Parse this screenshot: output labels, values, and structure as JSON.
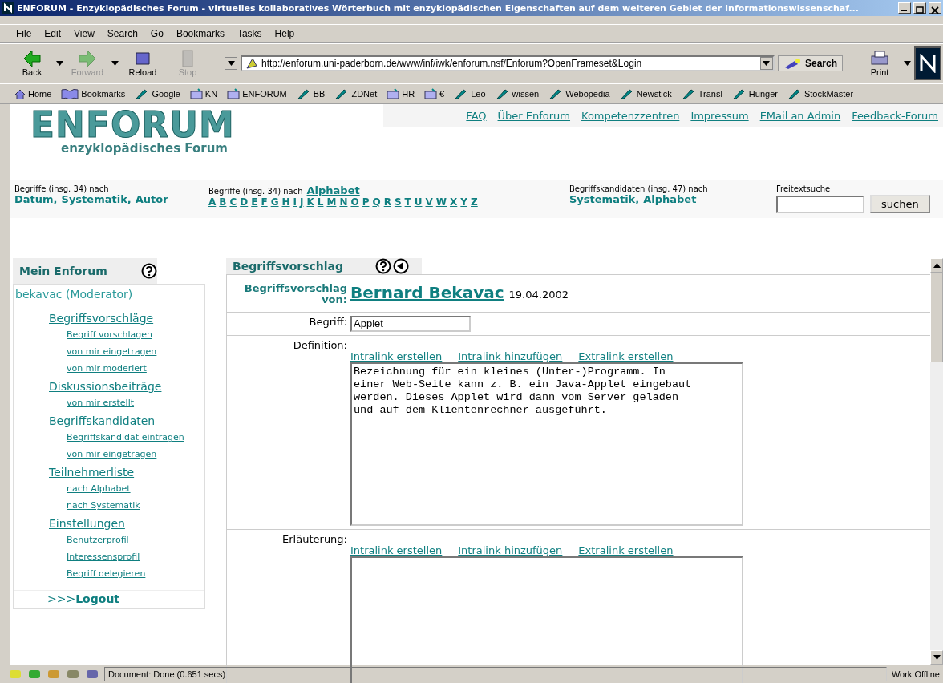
{
  "window": {
    "title": "ENFORUM - Enzyklopädisches Forum - virtuelles kollaboratives Wörterbuch mit enzyklopädischen Eigenschaften auf dem weiteren Gebiet der Informationswissenschaf..."
  },
  "menu": [
    "File",
    "Edit",
    "View",
    "Search",
    "Go",
    "Bookmarks",
    "Tasks",
    "Help"
  ],
  "toolbar": {
    "buttons": [
      {
        "label": "Back",
        "disabled": false,
        "dropdown": true
      },
      {
        "label": "Forward",
        "disabled": true,
        "dropdown": true
      },
      {
        "label": "Reload",
        "disabled": false,
        "dropdown": false
      },
      {
        "label": "Stop",
        "disabled": true,
        "dropdown": false
      }
    ],
    "url": "http://enforum.uni-paderborn.de/www/inf/iwk/enforum.nsf/Enforum?OpenFrameset&Login",
    "search": "Search",
    "print": "Print"
  },
  "bookmarks": [
    {
      "label": "Home",
      "kind": "home"
    },
    {
      "label": "Bookmarks",
      "kind": "book"
    },
    {
      "label": "Google",
      "kind": "link"
    },
    {
      "label": "KN",
      "kind": "folder"
    },
    {
      "label": "ENFORUM",
      "kind": "folder"
    },
    {
      "label": "BB",
      "kind": "link"
    },
    {
      "label": "ZDNet",
      "kind": "link"
    },
    {
      "label": "HR",
      "kind": "folder"
    },
    {
      "label": "€",
      "kind": "folder"
    },
    {
      "label": "Leo",
      "kind": "link"
    },
    {
      "label": "wissen",
      "kind": "link"
    },
    {
      "label": "Webopedia",
      "kind": "link"
    },
    {
      "label": "Newstick",
      "kind": "link"
    },
    {
      "label": "Transl",
      "kind": "link"
    },
    {
      "label": "Hunger",
      "kind": "link"
    },
    {
      "label": "StockMaster",
      "kind": "link"
    }
  ],
  "site": {
    "logo": "ENFORUM",
    "logo_subtitle": "enzyklopädisches Forum",
    "top_links": [
      "FAQ",
      "Über Enforum",
      "Kompetenzzentren",
      "Impressum",
      "EMail an Admin",
      "Feedback-Forum"
    ],
    "nav": [
      {
        "caption": "Begriffe (insg. 34)  nach",
        "links": [
          "Datum,",
          "Systematik,",
          "Autor"
        ]
      },
      {
        "caption": "Begriffe (insg. 34)  nach",
        "caption_link": "Alphabet",
        "letters": [
          "A",
          "B",
          "C",
          "D",
          "E",
          "F",
          "G",
          "H",
          "I",
          "J",
          "K",
          "L",
          "M",
          "N",
          "O",
          "P",
          "Q",
          "R",
          "S",
          "T",
          "U",
          "V",
          "W",
          "X",
          "Y",
          "Z"
        ]
      },
      {
        "caption": "Begriffskandidaten (insg. 47) nach",
        "links": [
          "Systematik,",
          "Alphabet"
        ]
      }
    ],
    "search": {
      "label": "Freitextsuche",
      "button": "suchen"
    }
  },
  "sidebar": {
    "title": "Mein Enforum",
    "user": "bekavac (Moderator)",
    "sections": [
      {
        "label": "Begriffsvorschläge",
        "children": [
          "Begriff vorschlagen",
          "von mir eingetragen",
          "von mir moderiert"
        ]
      },
      {
        "label": "Diskussionsbeiträge",
        "children": [
          "von mir erstellt"
        ]
      },
      {
        "label": "Begriffskandidaten",
        "children": [
          "Begriffskandidat eintragen",
          "von mir eingetragen"
        ]
      },
      {
        "label": "Teilnehmerliste",
        "children": [
          "nach Alphabet",
          "nach Systematik"
        ]
      },
      {
        "label": "Einstellungen",
        "children": [
          "Benutzerprofil",
          "Interessensprofil",
          "Begriff delegieren"
        ]
      }
    ],
    "logout_prefix": ">>>",
    "logout": "Logout"
  },
  "main": {
    "title": "Begriffsvorschlag",
    "author_label": "Begriffsvorschlag von:",
    "author": "Bernard Bekavac",
    "date": "19.04.2002",
    "term_label": "Begriff:",
    "term": "Applet",
    "fields": [
      {
        "label": "Definition:",
        "links": [
          "Intralink erstellen",
          "Intralink hinzufügen",
          "Extralink erstellen"
        ],
        "text": "Bezeichnung für ein kleines (Unter-)Programm. In\neiner Web-Seite kann z. B. ein Java-Applet eingebaut\nwerden. Dieses Applet wird dann vom Server geladen\nund auf dem Klientenrechner ausgeführt."
      },
      {
        "label": "Erläuterung:",
        "links": [
          "Intralink erstellen",
          "Intralink hinzufügen",
          "Extralink erstellen"
        ]
      }
    ]
  },
  "status_bar": {
    "text": "Document: Done (0.651 secs)",
    "offline": "Work Offline"
  }
}
